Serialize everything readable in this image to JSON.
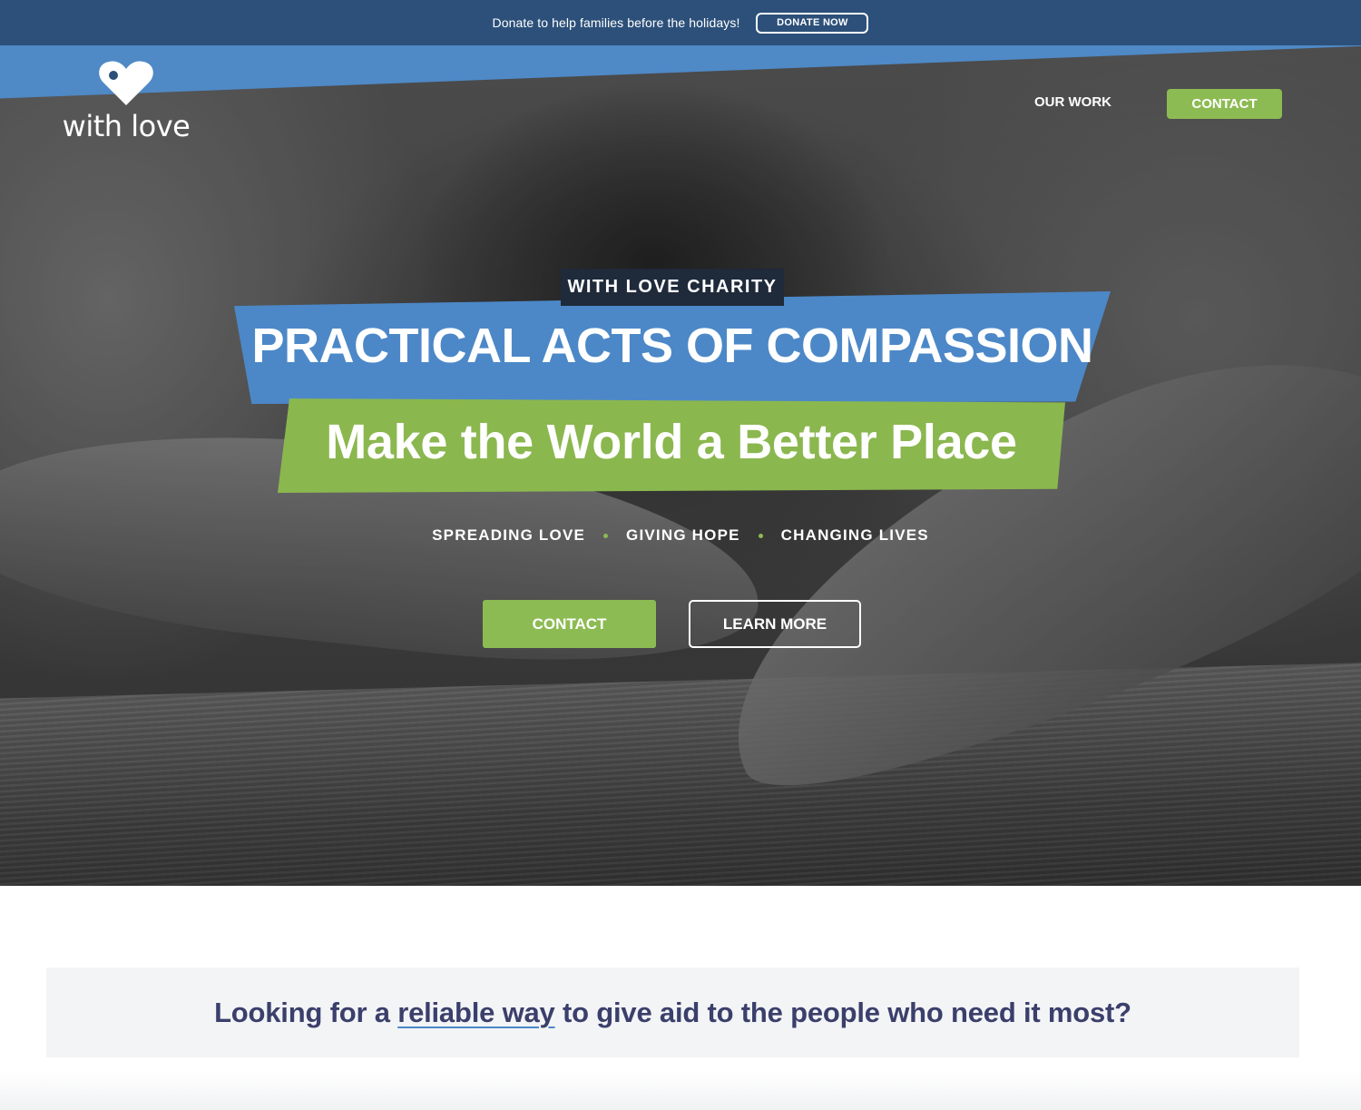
{
  "announcement": {
    "text": "Donate to help families before the holidays!",
    "button_label": "DONATE NOW"
  },
  "header": {
    "logo_text": "with love",
    "nav": {
      "our_work_label": "OUR WORK",
      "contact_label": "CONTACT"
    }
  },
  "hero": {
    "eyebrow": "WITH LOVE CHARITY",
    "headline_primary": "PRACTICAL ACTS OF COMPASSION",
    "headline_secondary": "Make the World a Better Place",
    "taglines": [
      "SPREADING LOVE",
      "GIVING HOPE",
      "CHANGING LIVES"
    ],
    "contact_button_label": "CONTACT",
    "learn_more_button_label": "LEARN MORE"
  },
  "intro": {
    "text_before": "Looking for a ",
    "link_text": "reliable way",
    "text_after": " to give aid to the people who need it most?"
  },
  "colors": {
    "topbar": "#2c5079",
    "brand_blue": "#4c88c8",
    "brand_green": "#8dbb53",
    "eyebrow_bg": "#1f2a3a",
    "intro_text": "#3b3f6b",
    "intro_bg": "#f3f4f6"
  },
  "icons": {
    "logo": "heart-tag-icon"
  }
}
